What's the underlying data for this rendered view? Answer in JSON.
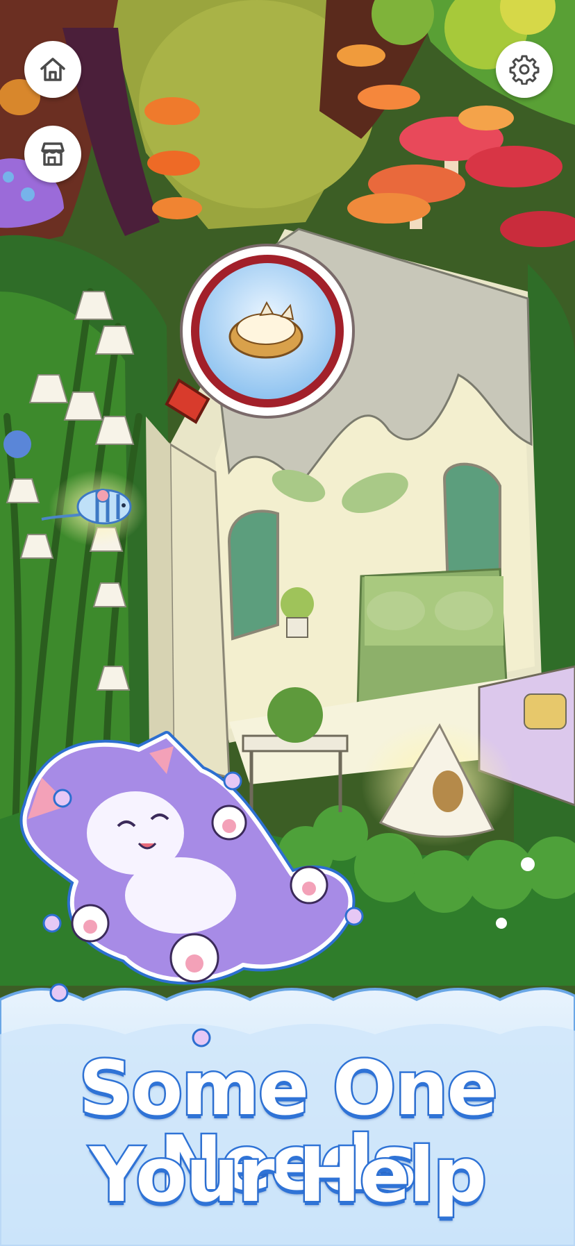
{
  "caption": {
    "line1": "Some One Needs",
    "line2": "Your Help"
  },
  "icons": {
    "home": "home-icon",
    "shop": "shop-icon",
    "settings": "gear-icon",
    "magnifier": "magnifying-glass-icon",
    "cat_bed": "cat-bed-icon",
    "mouse_toy": "toy-mouse-icon",
    "cone_tent": "cat-tent-icon"
  },
  "colors": {
    "caption_fill": "#ffffff",
    "caption_stroke": "#2f73d6",
    "cloud_band": "#d7ebfb",
    "cat_purple": "#a78be6",
    "button_bg": "#ffffff"
  }
}
